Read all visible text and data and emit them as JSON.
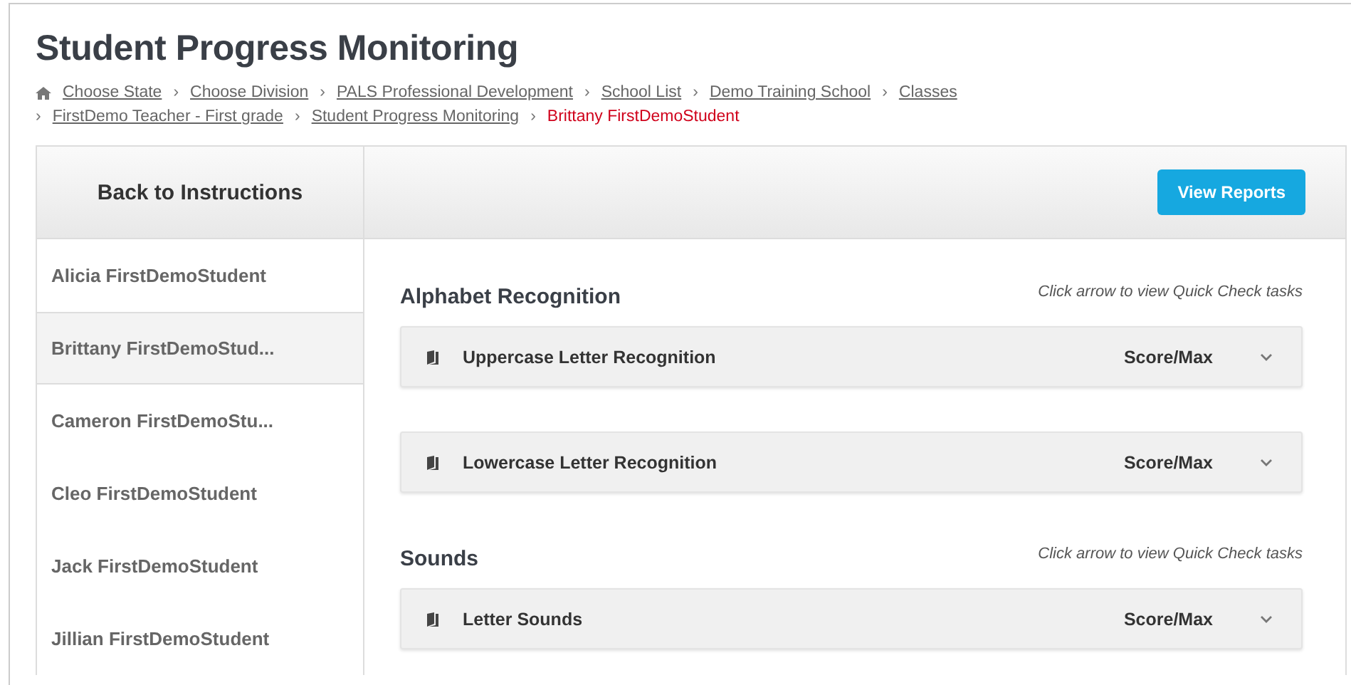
{
  "page_title": "Student Progress Monitoring",
  "breadcrumb": {
    "separator": "›",
    "lines": [
      {
        "items": [
          {
            "label": "Choose State",
            "current": false
          },
          {
            "label": "Choose Division",
            "current": false
          },
          {
            "label": "PALS Professional Development",
            "current": false
          },
          {
            "label": "School List",
            "current": false
          },
          {
            "label": "Demo Training School",
            "current": false
          },
          {
            "label": "Classes",
            "current": false
          }
        ]
      },
      {
        "items": [
          {
            "label": "FirstDemo Teacher - First grade",
            "current": false
          },
          {
            "label": "Student Progress Monitoring",
            "current": false
          },
          {
            "label": "Brittany FirstDemoStudent",
            "current": true
          }
        ]
      }
    ]
  },
  "back_button": "Back to Instructions",
  "view_reports_button": "View Reports",
  "students": [
    {
      "name": "Alicia FirstDemoStudent",
      "selected": false
    },
    {
      "name": "Brittany FirstDemoStud...",
      "selected": true
    },
    {
      "name": "Cameron FirstDemoStu...",
      "selected": false
    },
    {
      "name": "Cleo FirstDemoStudent",
      "selected": false
    },
    {
      "name": "Jack FirstDemoStudent",
      "selected": false
    },
    {
      "name": "Jillian FirstDemoStudent",
      "selected": false
    }
  ],
  "sections": [
    {
      "title": "Alphabet Recognition",
      "hint": "Click arrow to view Quick Check tasks",
      "tasks": [
        {
          "name": "Uppercase Letter Recognition",
          "score_label": "Score/Max",
          "expanded": false
        },
        {
          "name": "Lowercase Letter Recognition",
          "score_label": "Score/Max",
          "expanded": false
        }
      ]
    },
    {
      "title": "Sounds",
      "hint": "Click arrow to view Quick Check tasks",
      "tasks": [
        {
          "name": "Letter Sounds",
          "score_label": "Score/Max",
          "expanded": false
        }
      ]
    }
  ]
}
